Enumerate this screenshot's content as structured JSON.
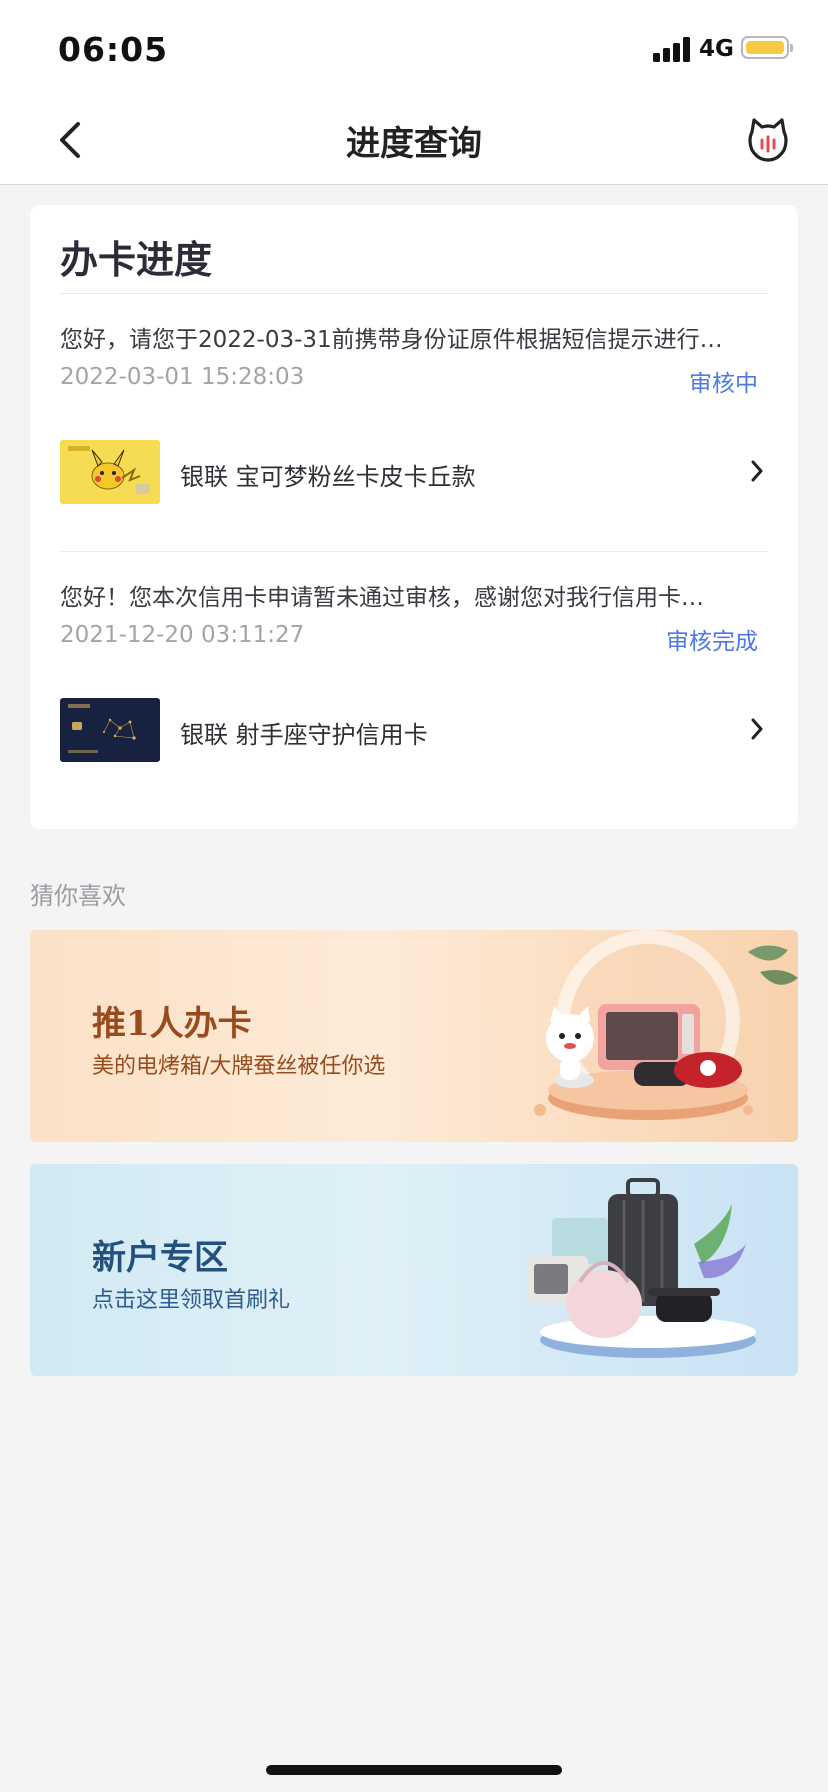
{
  "status_bar": {
    "time": "06:05",
    "network": "4G"
  },
  "nav": {
    "title": "进度查询",
    "back_icon": "chevron-left-icon",
    "service_icon": "cat-service-icon"
  },
  "progress_card": {
    "title": "办卡进度",
    "applications": [
      {
        "message": "您好，请您于2022-03-31前携带身份证原件根据短信提示进行…",
        "datetime": "2022-03-01 15:28:03",
        "status": "审核中",
        "card_name": "银联 宝可梦粉丝卡皮卡丘款"
      },
      {
        "message": "您好！您本次信用卡申请暂未通过审核，感谢您对我行信用卡…",
        "datetime": "2021-12-20 03:11:27",
        "status": "审核完成",
        "card_name": "银联 射手座守护信用卡"
      }
    ]
  },
  "recommend": {
    "title": "猜你喜欢",
    "banners": [
      {
        "title": "推1人办卡",
        "subtitle": "美的电烤箱/大牌蚕丝被任你选"
      },
      {
        "title": "新户专区",
        "subtitle": "点击这里领取首刷礼"
      }
    ]
  },
  "colors": {
    "status_link": "#4d78e6",
    "background": "#f4f4f5"
  }
}
